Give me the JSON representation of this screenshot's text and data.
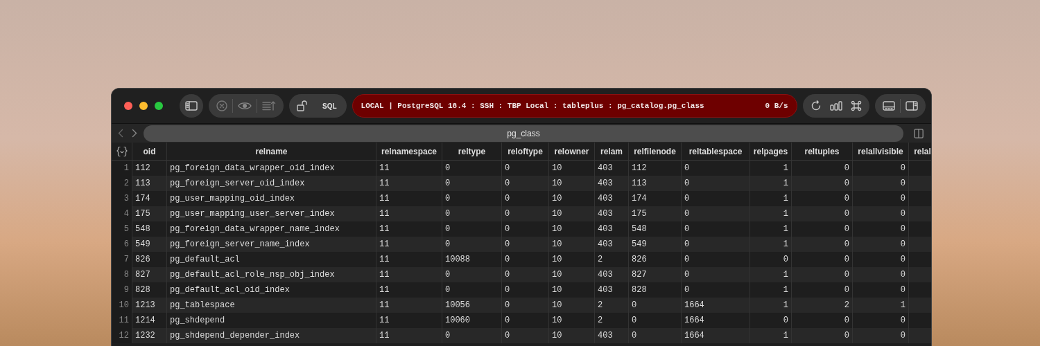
{
  "toolbar": {
    "sql_label": "SQL",
    "connection": {
      "text": "LOCAL | PostgreSQL 18.4 : SSH : TBP Local : tableplus : pg_catalog.pg_class",
      "speed": "0 B/s"
    }
  },
  "tabs": [
    {
      "label": "pg_class",
      "selected": true
    }
  ],
  "table": {
    "columns": [
      {
        "label": "oid",
        "kind": "text"
      },
      {
        "label": "relname",
        "kind": "text"
      },
      {
        "label": "relnamespace",
        "kind": "text"
      },
      {
        "label": "reltype",
        "kind": "text"
      },
      {
        "label": "reloftype",
        "kind": "text"
      },
      {
        "label": "relowner",
        "kind": "text"
      },
      {
        "label": "relam",
        "kind": "text"
      },
      {
        "label": "relfilenode",
        "kind": "text"
      },
      {
        "label": "reltablespace",
        "kind": "text"
      },
      {
        "label": "relpages",
        "kind": "number"
      },
      {
        "label": "reltuples",
        "kind": "number"
      },
      {
        "label": "relallvisible",
        "kind": "number"
      },
      {
        "label": "relal",
        "kind": "text"
      }
    ],
    "rows": [
      {
        "number": "1",
        "cells": [
          "112",
          "pg_foreign_data_wrapper_oid_index",
          "11",
          "0",
          "0",
          "10",
          "403",
          "112",
          "0",
          "1",
          "0",
          "0"
        ]
      },
      {
        "number": "2",
        "cells": [
          "113",
          "pg_foreign_server_oid_index",
          "11",
          "0",
          "0",
          "10",
          "403",
          "113",
          "0",
          "1",
          "0",
          "0"
        ]
      },
      {
        "number": "3",
        "cells": [
          "174",
          "pg_user_mapping_oid_index",
          "11",
          "0",
          "0",
          "10",
          "403",
          "174",
          "0",
          "1",
          "0",
          "0"
        ]
      },
      {
        "number": "4",
        "cells": [
          "175",
          "pg_user_mapping_user_server_index",
          "11",
          "0",
          "0",
          "10",
          "403",
          "175",
          "0",
          "1",
          "0",
          "0"
        ]
      },
      {
        "number": "5",
        "cells": [
          "548",
          "pg_foreign_data_wrapper_name_index",
          "11",
          "0",
          "0",
          "10",
          "403",
          "548",
          "0",
          "1",
          "0",
          "0"
        ]
      },
      {
        "number": "6",
        "cells": [
          "549",
          "pg_foreign_server_name_index",
          "11",
          "0",
          "0",
          "10",
          "403",
          "549",
          "0",
          "1",
          "0",
          "0"
        ]
      },
      {
        "number": "7",
        "cells": [
          "826",
          "pg_default_acl",
          "11",
          "10088",
          "0",
          "10",
          "2",
          "826",
          "0",
          "0",
          "0",
          "0"
        ]
      },
      {
        "number": "8",
        "cells": [
          "827",
          "pg_default_acl_role_nsp_obj_index",
          "11",
          "0",
          "0",
          "10",
          "403",
          "827",
          "0",
          "1",
          "0",
          "0"
        ]
      },
      {
        "number": "9",
        "cells": [
          "828",
          "pg_default_acl_oid_index",
          "11",
          "0",
          "0",
          "10",
          "403",
          "828",
          "0",
          "1",
          "0",
          "0"
        ]
      },
      {
        "number": "10",
        "cells": [
          "1213",
          "pg_tablespace",
          "11",
          "10056",
          "0",
          "10",
          "2",
          "0",
          "1664",
          "1",
          "2",
          "1"
        ]
      },
      {
        "number": "11",
        "cells": [
          "1214",
          "pg_shdepend",
          "11",
          "10060",
          "0",
          "10",
          "2",
          "0",
          "1664",
          "0",
          "0",
          "0"
        ]
      },
      {
        "number": "12",
        "cells": [
          "1232",
          "pg_shdepend_depender_index",
          "11",
          "0",
          "0",
          "10",
          "403",
          "0",
          "1664",
          "1",
          "0",
          "0"
        ]
      }
    ]
  }
}
